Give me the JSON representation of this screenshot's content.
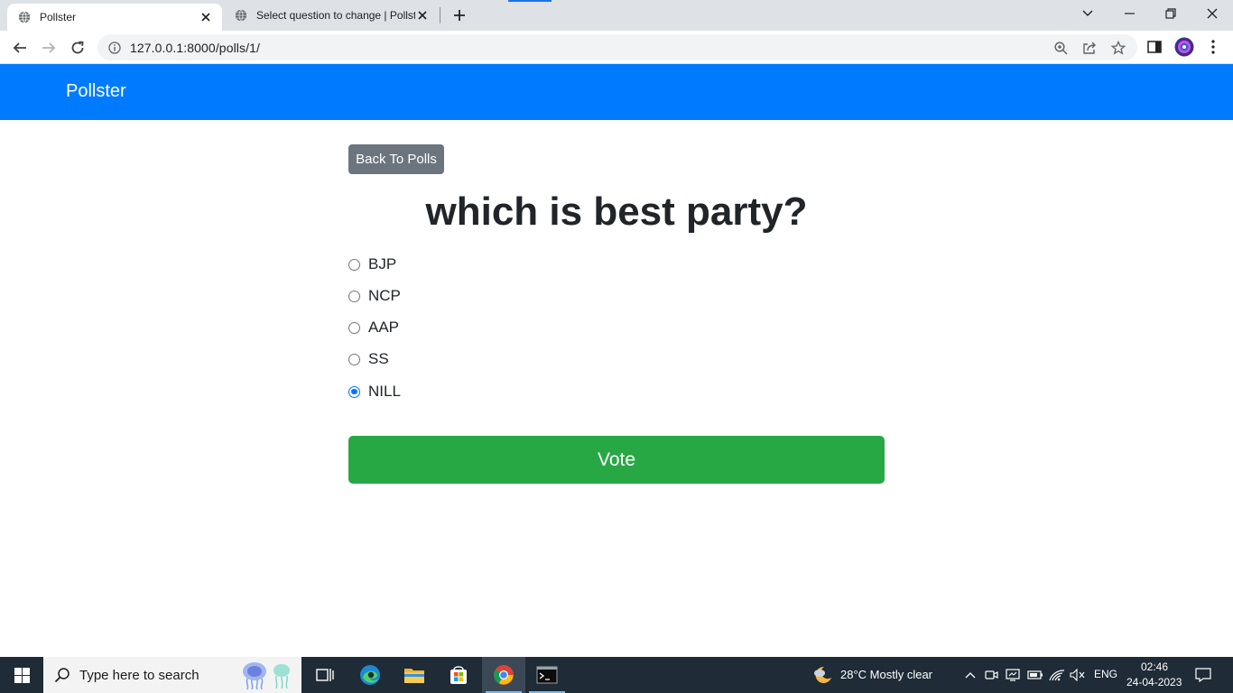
{
  "browser": {
    "tabs": [
      {
        "title": "Pollster",
        "active": true
      },
      {
        "title": "Select question to change | Pollster",
        "active": false
      }
    ],
    "url": "127.0.0.1:8000/polls/1/"
  },
  "page": {
    "brand": "Pollster",
    "back_label": "Back To Polls",
    "question": "which is best party?",
    "choices": [
      {
        "label": "BJP",
        "checked": false
      },
      {
        "label": "NCP",
        "checked": false
      },
      {
        "label": "AAP",
        "checked": false
      },
      {
        "label": "SS",
        "checked": false
      },
      {
        "label": "NILL",
        "checked": true
      }
    ],
    "vote_label": "Vote"
  },
  "taskbar": {
    "search_placeholder": "Type here to search",
    "weather": "28°C  Mostly clear",
    "language": "ENG",
    "time": "02:46",
    "date": "24-04-2023"
  },
  "colors": {
    "navbar": "#007bff",
    "back_button": "#6c757d",
    "vote_button": "#28a745",
    "radio_checked": "#0075ff",
    "taskbar": "#1f2b36"
  }
}
